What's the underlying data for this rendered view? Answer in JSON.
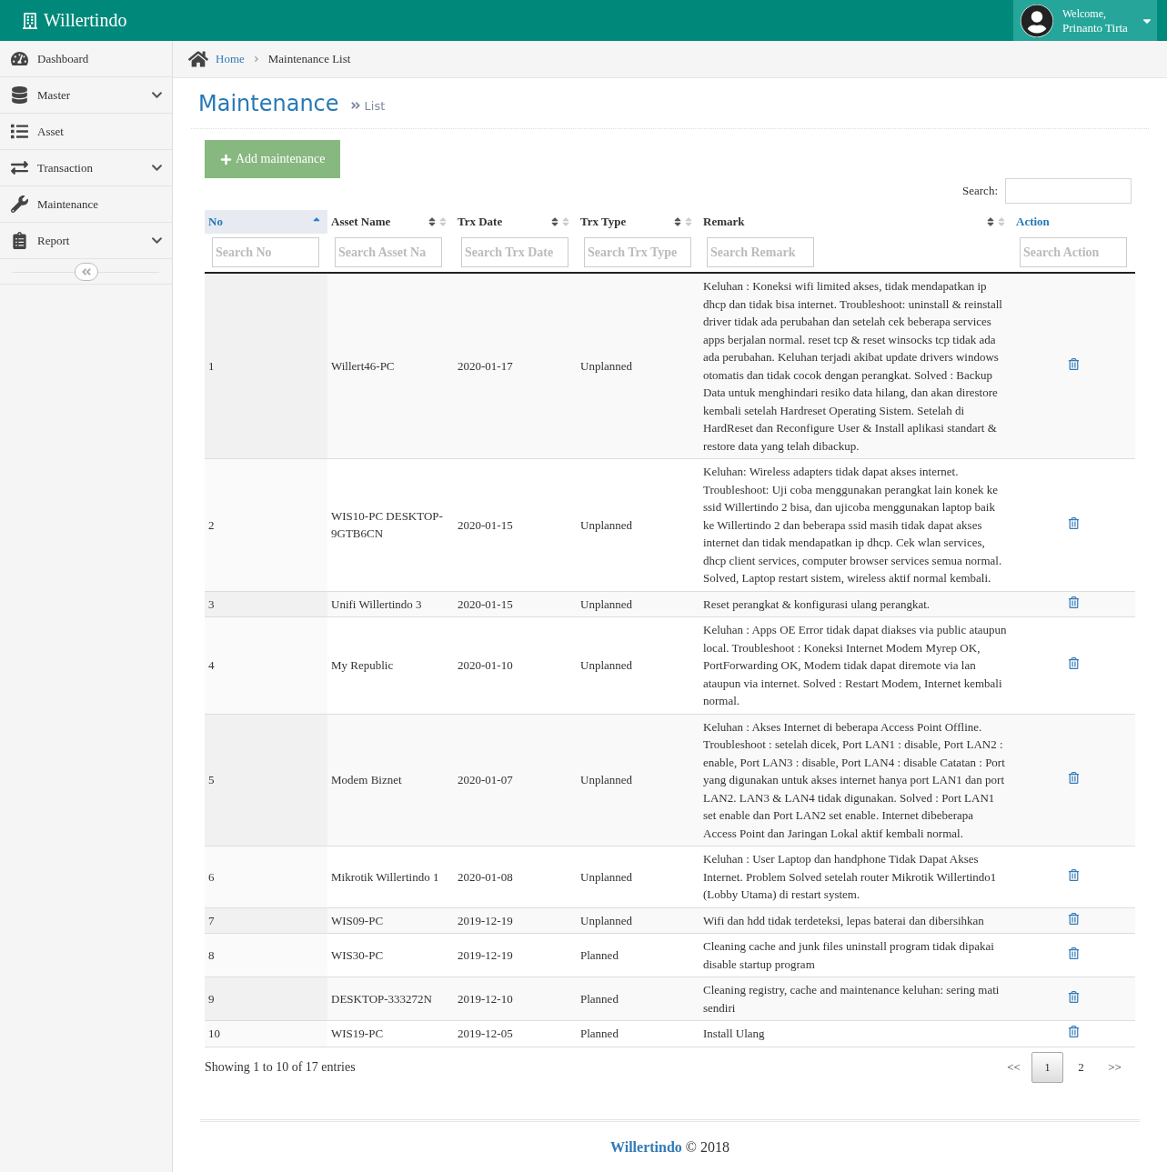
{
  "header": {
    "brand": "Willertindo",
    "welcome": "Welcome,",
    "user": "Prinanto Tirta"
  },
  "sidebar": {
    "items": [
      {
        "label": "Dashboard",
        "expandable": false
      },
      {
        "label": "Master",
        "expandable": true
      },
      {
        "label": "Asset",
        "expandable": false
      },
      {
        "label": "Transaction",
        "expandable": true
      },
      {
        "label": "Maintenance",
        "expandable": false
      },
      {
        "label": "Report",
        "expandable": true
      }
    ]
  },
  "breadcrumb": {
    "home": "Home",
    "current": "Maintenance List"
  },
  "page": {
    "title": "Maintenance",
    "subtitle": "List"
  },
  "add_button": "Add maintenance",
  "search": {
    "label": "Search:"
  },
  "table": {
    "columns": [
      {
        "label": "No",
        "sortable": true,
        "selected": true,
        "placeholder": "Search No"
      },
      {
        "label": "Asset Name",
        "sortable": true,
        "selected": false,
        "placeholder": "Search Asset Na"
      },
      {
        "label": "Trx Date",
        "sortable": true,
        "selected": false,
        "placeholder": "Search Trx Date"
      },
      {
        "label": "Trx Type",
        "sortable": true,
        "selected": false,
        "placeholder": "Search Trx Type"
      },
      {
        "label": "Remark",
        "sortable": true,
        "selected": false,
        "placeholder": "Search Remark"
      },
      {
        "label": "Action",
        "sortable": false,
        "placeholder": "Search Action"
      }
    ],
    "rows": [
      {
        "no": "1",
        "asset": "Willert46-PC",
        "date": "2020-01-17",
        "type": "Unplanned",
        "remark": "Keluhan : Koneksi wifi limited akses, tidak mendapatkan ip dhcp dan tidak bisa internet. Troubleshoot: uninstall & reinstall driver tidak ada perubahan dan setelah cek beberapa services apps berjalan normal. reset tcp & reset winsocks tcp tidak ada ada perubahan. Keluhan terjadi akibat update drivers windows otomatis dan tidak cocok dengan perangkat. Solved : Backup Data untuk menghindari resiko data hilang, dan akan direstore kembali setelah Hardreset Operating Sistem. Setelah di HardReset dan Reconfigure User & Install aplikasi standart & restore data yang telah dibackup."
      },
      {
        "no": "2",
        "asset": "WIS10-PC DESKTOP-9GTB6CN",
        "date": "2020-01-15",
        "type": "Unplanned",
        "remark": "Keluhan: Wireless adapters tidak dapat akses internet. Troubleshoot: Uji coba menggunakan perangkat lain konek ke ssid Willertindo 2 bisa, dan ujicoba menggunakan laptop baik ke Willertindo 2 dan beberapa ssid masih tidak dapat akses internet dan tidak mendapatkan ip dhcp. Cek wlan services, dhcp client services, computer browser services semua normal. Solved, Laptop restart sistem, wireless aktif normal kembali."
      },
      {
        "no": "3",
        "asset": "Unifi Willertindo 3",
        "date": "2020-01-15",
        "type": "Unplanned",
        "remark": "Reset perangkat & konfigurasi ulang perangkat."
      },
      {
        "no": "4",
        "asset": "My Republic",
        "date": "2020-01-10",
        "type": "Unplanned",
        "remark": "Keluhan : Apps OE Error tidak dapat diakses via public ataupun local. Troubleshoot : Koneksi Internet Modem Myrep OK, PortForwarding OK, Modem tidak dapat diremote via lan ataupun via internet. Solved : Restart Modem, Internet kembali normal."
      },
      {
        "no": "5",
        "asset": "Modem Biznet",
        "date": "2020-01-07",
        "type": "Unplanned",
        "remark": "Keluhan : Akses Internet di beberapa Access Point Offline. Troubleshoot : setelah dicek, Port LAN1 : disable, Port LAN2 : enable, Port LAN3 : disable, Port LAN4 : disable Catatan : Port yang digunakan untuk akses internet hanya port LAN1 dan port LAN2. LAN3 & LAN4 tidak digunakan. Solved : Port LAN1 set enable dan Port LAN2 set enable. Internet dibeberapa Access Point dan Jaringan Lokal aktif kembali normal."
      },
      {
        "no": "6",
        "asset": "Mikrotik Willertindo 1",
        "date": "2020-01-08",
        "type": "Unplanned",
        "remark": "Keluhan : User Laptop dan handphone Tidak Dapat Akses Internet. Problem Solved setelah router Mikrotik Willertindo1 (Lobby Utama) di restart system."
      },
      {
        "no": "7",
        "asset": "WIS09-PC",
        "date": "2019-12-19",
        "type": "Unplanned",
        "remark": "Wifi dan hdd tidak terdeteksi, lepas baterai dan dibersihkan"
      },
      {
        "no": "8",
        "asset": "WIS30-PC",
        "date": "2019-12-19",
        "type": "Planned",
        "remark": "Cleaning cache and junk files uninstall program tidak dipakai disable startup program"
      },
      {
        "no": "9",
        "asset": "DESKTOP-333272N",
        "date": "2019-12-10",
        "type": "Planned",
        "remark": "Cleaning registry, cache and maintenance keluhan: sering mati sendiri"
      },
      {
        "no": "10",
        "asset": "WIS19-PC",
        "date": "2019-12-05",
        "type": "Planned",
        "remark": "Install Ulang"
      }
    ]
  },
  "info": "Showing 1 to 10 of 17 entries",
  "pagination": [
    {
      "label": "<<",
      "selected": false
    },
    {
      "label": "1",
      "selected": true
    },
    {
      "label": "2",
      "selected": false
    },
    {
      "label": ">>",
      "selected": false
    }
  ],
  "footer": {
    "brand": "Willertindo",
    "copyright": "© 2018"
  }
}
